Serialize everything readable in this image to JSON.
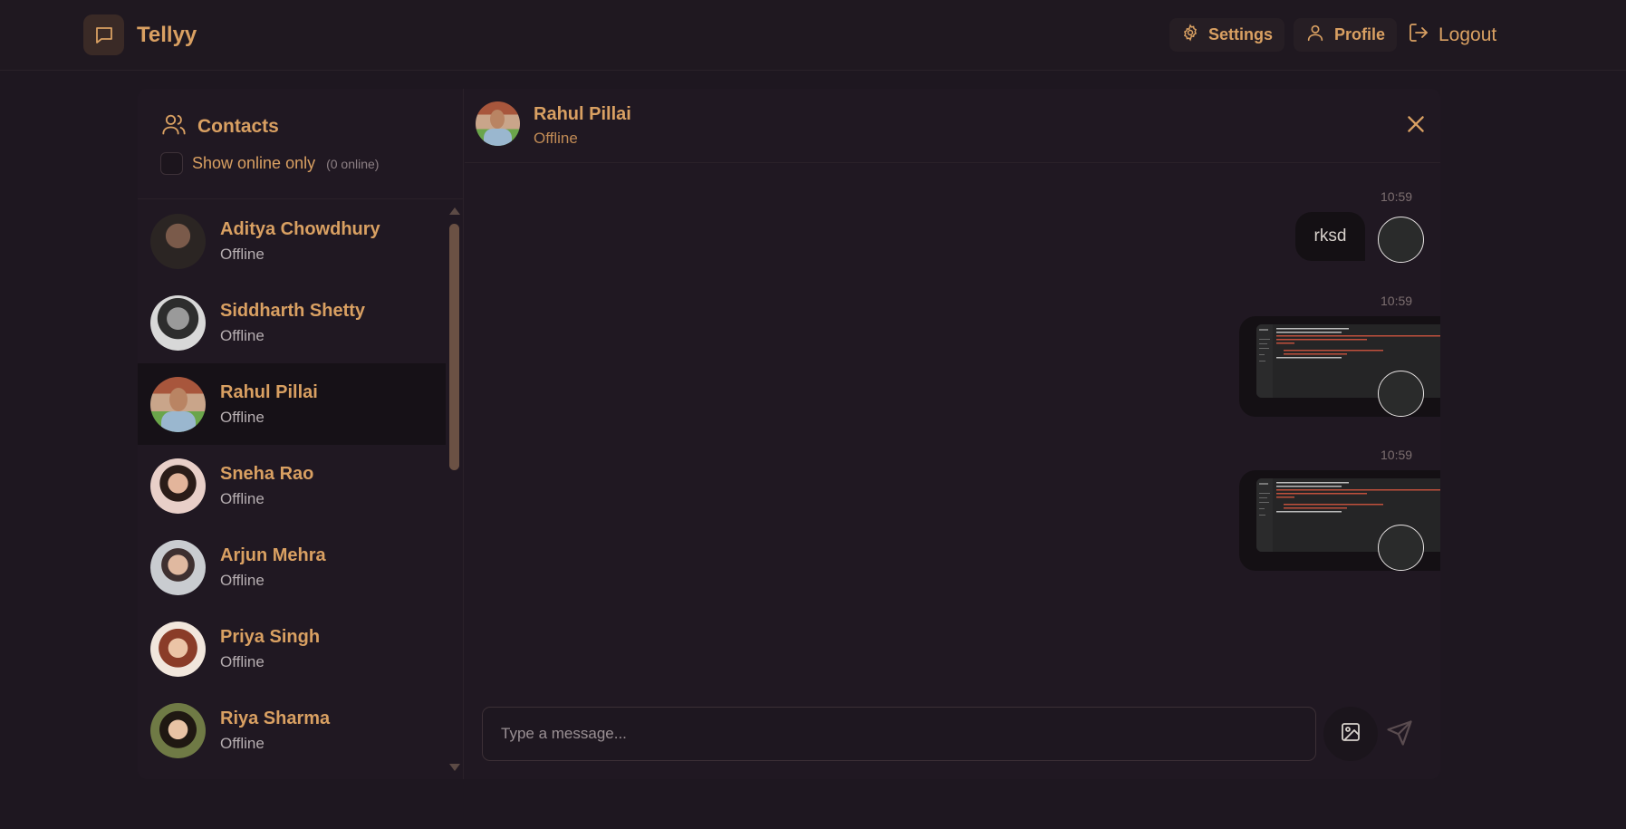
{
  "navbar": {
    "brand": "Tellyy",
    "settings_label": "Settings",
    "profile_label": "Profile",
    "logout_label": "Logout"
  },
  "sidebar": {
    "title": "Contacts",
    "filter_label": "Show online only",
    "online_count": "(0 online)",
    "contacts": [
      {
        "name": "Aditya Chowdhury",
        "status": "Offline",
        "active": false
      },
      {
        "name": "Siddharth Shetty",
        "status": "Offline",
        "active": false
      },
      {
        "name": "Rahul Pillai",
        "status": "Offline",
        "active": true
      },
      {
        "name": "Sneha Rao",
        "status": "Offline",
        "active": false
      },
      {
        "name": "Arjun Mehra",
        "status": "Offline",
        "active": false
      },
      {
        "name": "Priya Singh",
        "status": "Offline",
        "active": false
      },
      {
        "name": "Riya Sharma",
        "status": "Offline",
        "active": false
      }
    ]
  },
  "chat": {
    "contact_name": "Rahul Pillai",
    "contact_status": "Offline",
    "messages": [
      {
        "time": "10:59",
        "type": "text",
        "text": "rksd"
      },
      {
        "time": "10:59",
        "type": "image"
      },
      {
        "time": "10:59",
        "type": "image"
      }
    ],
    "input_placeholder": "Type a message..."
  },
  "colors": {
    "background": "#1e1720",
    "accent": "#d9a062",
    "bubble": "#141014"
  }
}
